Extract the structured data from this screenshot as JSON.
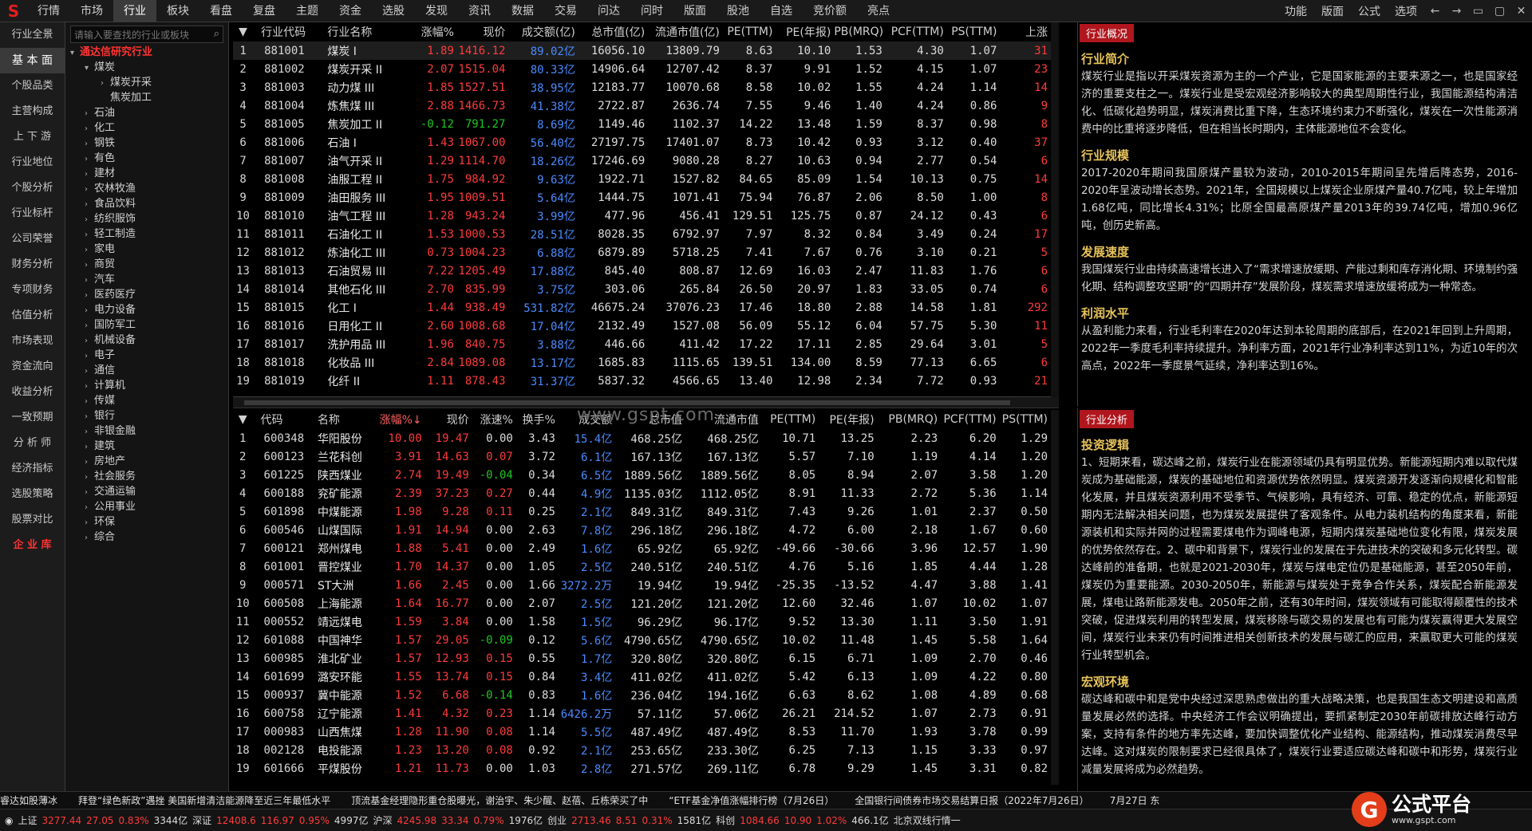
{
  "menubar": {
    "logo": "S",
    "items": [
      "行情",
      "市场",
      "行业",
      "板块",
      "看盘",
      "复盘",
      "主题",
      "资金",
      "选股",
      "发现",
      "资讯",
      "数据",
      "交易",
      "问达",
      "问时",
      "版面",
      "股池",
      "自选",
      "竞价额",
      "亮点"
    ],
    "active_index": 2,
    "right_items": [
      "功能",
      "版面",
      "公式",
      "选项"
    ],
    "window_buttons": [
      "←",
      "→",
      "▭",
      "▢",
      "✕"
    ]
  },
  "nav": {
    "items": [
      "行业全景",
      "基 本 面",
      "个股品类",
      "主营构成",
      "上 下 游",
      "行业地位",
      "个股分析",
      "行业标杆",
      "公司荣誉",
      "财务分析",
      "专项财务",
      "估值分析",
      "市场表现",
      "资金流向",
      "收益分析",
      "一致预期",
      "分 析 师",
      "经济指标",
      "选股策略",
      "股票对比",
      "企 业 库"
    ],
    "active_index": 1,
    "red_index": 20
  },
  "tree": {
    "search_placeholder": "请输入要查找的行业或板块",
    "root": "通达信研究行业",
    "items": [
      {
        "label": "煤炭",
        "level": 1,
        "arrow": "▾"
      },
      {
        "label": "煤炭开采",
        "level": 2,
        "arrow": "›"
      },
      {
        "label": "焦炭加工",
        "level": 2,
        "arrow": ""
      },
      {
        "label": "石油",
        "level": 1,
        "arrow": "›"
      },
      {
        "label": "化工",
        "level": 1,
        "arrow": "›"
      },
      {
        "label": "钢铁",
        "level": 1,
        "arrow": "›"
      },
      {
        "label": "有色",
        "level": 1,
        "arrow": "›"
      },
      {
        "label": "建材",
        "level": 1,
        "arrow": "›"
      },
      {
        "label": "农林牧渔",
        "level": 1,
        "arrow": "›"
      },
      {
        "label": "食品饮料",
        "level": 1,
        "arrow": "›"
      },
      {
        "label": "纺织服饰",
        "level": 1,
        "arrow": "›"
      },
      {
        "label": "轻工制造",
        "level": 1,
        "arrow": "›"
      },
      {
        "label": "家电",
        "level": 1,
        "arrow": "›"
      },
      {
        "label": "商贸",
        "level": 1,
        "arrow": "›"
      },
      {
        "label": "汽车",
        "level": 1,
        "arrow": "›"
      },
      {
        "label": "医药医疗",
        "level": 1,
        "arrow": "›"
      },
      {
        "label": "电力设备",
        "level": 1,
        "arrow": "›"
      },
      {
        "label": "国防军工",
        "level": 1,
        "arrow": "›"
      },
      {
        "label": "机械设备",
        "level": 1,
        "arrow": "›"
      },
      {
        "label": "电子",
        "level": 1,
        "arrow": "›"
      },
      {
        "label": "通信",
        "level": 1,
        "arrow": "›"
      },
      {
        "label": "计算机",
        "level": 1,
        "arrow": "›"
      },
      {
        "label": "传媒",
        "level": 1,
        "arrow": "›"
      },
      {
        "label": "银行",
        "level": 1,
        "arrow": "›"
      },
      {
        "label": "非银金融",
        "level": 1,
        "arrow": "›"
      },
      {
        "label": "建筑",
        "level": 1,
        "arrow": "›"
      },
      {
        "label": "房地产",
        "level": 1,
        "arrow": "›"
      },
      {
        "label": "社会服务",
        "level": 1,
        "arrow": "›"
      },
      {
        "label": "交通运输",
        "level": 1,
        "arrow": "›"
      },
      {
        "label": "公用事业",
        "level": 1,
        "arrow": "›"
      },
      {
        "label": "环保",
        "level": 1,
        "arrow": "›"
      },
      {
        "label": "综合",
        "level": 1,
        "arrow": "›"
      }
    ]
  },
  "industry_table": {
    "sort_icon": "▼",
    "headers": [
      "行业代码",
      "行业名称",
      "涨幅%",
      "现价",
      "成交额(亿)",
      "总市值(亿)",
      "流通市值(亿)",
      "PE(TTM)",
      "PE(年报)",
      "PB(MRQ)",
      "PCF(TTM)",
      "PS(TTM)",
      "上涨"
    ],
    "rows": [
      [
        "1",
        "881001",
        "煤炭 I",
        "1.89",
        "1416.12",
        "89.02亿",
        "16056.10",
        "13809.79",
        "8.63",
        "10.10",
        "1.53",
        "4.30",
        "1.07",
        "31"
      ],
      [
        "2",
        "881002",
        "煤炭开采 II",
        "2.07",
        "1515.04",
        "80.33亿",
        "14906.64",
        "12707.42",
        "8.37",
        "9.91",
        "1.52",
        "4.15",
        "1.07",
        "23"
      ],
      [
        "3",
        "881003",
        "动力煤 III",
        "1.85",
        "1527.51",
        "38.95亿",
        "12183.77",
        "10070.68",
        "8.58",
        "10.02",
        "1.55",
        "4.24",
        "1.14",
        "14"
      ],
      [
        "4",
        "881004",
        "炼焦煤 III",
        "2.88",
        "1466.73",
        "41.38亿",
        "2722.87",
        "2636.74",
        "7.55",
        "9.46",
        "1.40",
        "4.24",
        "0.86",
        "9"
      ],
      [
        "5",
        "881005",
        "焦炭加工 II",
        "-0.12",
        "791.27",
        "8.69亿",
        "1149.46",
        "1102.37",
        "14.22",
        "13.48",
        "1.59",
        "8.37",
        "0.98",
        "8"
      ],
      [
        "6",
        "881006",
        "石油 I",
        "1.43",
        "1067.00",
        "56.40亿",
        "27197.75",
        "17401.07",
        "8.73",
        "10.42",
        "0.93",
        "3.12",
        "0.40",
        "37"
      ],
      [
        "7",
        "881007",
        "油气开采 II",
        "1.29",
        "1114.70",
        "18.26亿",
        "17246.69",
        "9080.28",
        "8.27",
        "10.63",
        "0.94",
        "2.77",
        "0.54",
        "6"
      ],
      [
        "8",
        "881008",
        "油服工程 II",
        "1.75",
        "984.92",
        "9.63亿",
        "1922.71",
        "1527.82",
        "84.65",
        "85.09",
        "1.54",
        "10.13",
        "0.75",
        "14"
      ],
      [
        "9",
        "881009",
        "油田服务 III",
        "1.95",
        "1009.51",
        "5.64亿",
        "1444.75",
        "1071.41",
        "75.94",
        "76.87",
        "2.06",
        "8.50",
        "1.00",
        "8"
      ],
      [
        "10",
        "881010",
        "油气工程 III",
        "1.28",
        "943.24",
        "3.99亿",
        "477.96",
        "456.41",
        "129.51",
        "125.75",
        "0.87",
        "24.12",
        "0.43",
        "6"
      ],
      [
        "11",
        "881011",
        "石油化工 II",
        "1.53",
        "1000.53",
        "28.51亿",
        "8028.35",
        "6792.97",
        "7.97",
        "8.32",
        "0.84",
        "3.49",
        "0.24",
        "17"
      ],
      [
        "12",
        "881012",
        "炼油化工 III",
        "0.73",
        "1004.23",
        "6.88亿",
        "6879.89",
        "5718.25",
        "7.41",
        "7.67",
        "0.76",
        "3.10",
        "0.21",
        "5"
      ],
      [
        "13",
        "881013",
        "石油贸易 III",
        "7.22",
        "1205.49",
        "17.88亿",
        "845.40",
        "808.87",
        "12.69",
        "16.03",
        "2.47",
        "11.83",
        "1.76",
        "6"
      ],
      [
        "14",
        "881014",
        "其他石化 III",
        "2.70",
        "835.99",
        "3.75亿",
        "303.06",
        "265.84",
        "26.50",
        "20.97",
        "1.83",
        "33.05",
        "0.74",
        "6"
      ],
      [
        "15",
        "881015",
        "化工 I",
        "1.44",
        "938.49",
        "531.82亿",
        "46675.24",
        "37076.23",
        "17.46",
        "18.80",
        "2.88",
        "14.58",
        "1.81",
        "292"
      ],
      [
        "16",
        "881016",
        "日用化工 II",
        "2.60",
        "1008.68",
        "17.04亿",
        "2132.49",
        "1527.08",
        "56.09",
        "55.12",
        "6.04",
        "57.75",
        "5.30",
        "11"
      ],
      [
        "17",
        "881017",
        "洗护用品 III",
        "1.96",
        "840.75",
        "3.88亿",
        "446.66",
        "411.42",
        "17.22",
        "17.11",
        "2.85",
        "29.64",
        "3.01",
        "5"
      ],
      [
        "18",
        "881018",
        "化妆品 III",
        "2.84",
        "1089.08",
        "13.17亿",
        "1685.83",
        "1115.65",
        "139.51",
        "134.00",
        "8.59",
        "77.13",
        "6.65",
        "6"
      ],
      [
        "19",
        "881019",
        "化纤 II",
        "1.11",
        "878.43",
        "31.37亿",
        "5837.32",
        "4566.65",
        "13.40",
        "12.98",
        "2.34",
        "7.72",
        "0.93",
        "21"
      ]
    ]
  },
  "watermark": "www.gspt.com",
  "stock_table": {
    "sort_icon": "▼",
    "headers": [
      "代码",
      "名称",
      "涨幅%↓",
      "现价",
      "涨速%",
      "换手%",
      "成交额",
      "总市值",
      "流通市值",
      "PE(TTM)",
      "PE(年报)",
      "PB(MRQ)",
      "PCF(TTM)",
      "PS(TTM)"
    ],
    "rows": [
      [
        "1",
        "600348",
        "华阳股份",
        "10.00",
        "19.47",
        "0.00",
        "3.43",
        "15.4亿",
        "468.25亿",
        "468.25亿",
        "10.71",
        "13.25",
        "2.23",
        "6.20",
        "1.29"
      ],
      [
        "2",
        "600123",
        "兰花科创",
        "3.91",
        "14.63",
        "0.07",
        "3.72",
        "6.1亿",
        "167.13亿",
        "167.13亿",
        "5.57",
        "7.10",
        "1.19",
        "4.14",
        "1.20"
      ],
      [
        "3",
        "601225",
        "陕西煤业",
        "2.74",
        "19.49",
        "-0.04",
        "0.34",
        "6.5亿",
        "1889.56亿",
        "1889.56亿",
        "8.05",
        "8.94",
        "2.07",
        "3.58",
        "1.20"
      ],
      [
        "4",
        "600188",
        "兖矿能源",
        "2.39",
        "37.23",
        "0.27",
        "0.44",
        "4.9亿",
        "1135.03亿",
        "1112.05亿",
        "8.91",
        "11.33",
        "2.72",
        "5.36",
        "1.14"
      ],
      [
        "5",
        "601898",
        "中煤能源",
        "1.98",
        "9.28",
        "0.11",
        "0.25",
        "2.1亿",
        "849.31亿",
        "849.31亿",
        "7.43",
        "9.26",
        "1.01",
        "2.37",
        "0.50"
      ],
      [
        "6",
        "600546",
        "山煤国际",
        "1.91",
        "14.94",
        "0.00",
        "2.63",
        "7.8亿",
        "296.18亿",
        "296.18亿",
        "4.72",
        "6.00",
        "2.18",
        "1.67",
        "0.60"
      ],
      [
        "7",
        "600121",
        "郑州煤电",
        "1.88",
        "5.41",
        "0.00",
        "2.49",
        "1.6亿",
        "65.92亿",
        "65.92亿",
        "-49.66",
        "-30.66",
        "3.96",
        "12.57",
        "1.90"
      ],
      [
        "8",
        "601001",
        "晋控煤业",
        "1.70",
        "14.37",
        "0.00",
        "1.05",
        "2.5亿",
        "240.51亿",
        "240.51亿",
        "4.76",
        "5.16",
        "1.85",
        "4.44",
        "1.28"
      ],
      [
        "9",
        "000571",
        "ST大洲",
        "1.66",
        "2.45",
        "0.00",
        "1.66",
        "3272.2万",
        "19.94亿",
        "19.94亿",
        "-25.35",
        "-13.52",
        "4.47",
        "3.88",
        "1.41"
      ],
      [
        "10",
        "600508",
        "上海能源",
        "1.64",
        "16.77",
        "0.00",
        "2.07",
        "2.5亿",
        "121.20亿",
        "121.20亿",
        "12.60",
        "32.46",
        "1.07",
        "10.02",
        "1.07"
      ],
      [
        "11",
        "000552",
        "靖远煤电",
        "1.59",
        "3.84",
        "0.00",
        "1.58",
        "1.5亿",
        "96.29亿",
        "96.17亿",
        "9.52",
        "13.30",
        "1.11",
        "3.50",
        "1.91"
      ],
      [
        "12",
        "601088",
        "中国神华",
        "1.57",
        "29.05",
        "-0.09",
        "0.12",
        "5.6亿",
        "4790.65亿",
        "4790.65亿",
        "10.02",
        "11.48",
        "1.45",
        "5.58",
        "1.64"
      ],
      [
        "13",
        "600985",
        "淮北矿业",
        "1.57",
        "12.93",
        "0.15",
        "0.55",
        "1.7亿",
        "320.80亿",
        "320.80亿",
        "6.15",
        "6.71",
        "1.09",
        "2.70",
        "0.46"
      ],
      [
        "14",
        "601699",
        "潞安环能",
        "1.55",
        "13.74",
        "0.15",
        "0.84",
        "3.4亿",
        "411.02亿",
        "411.02亿",
        "5.42",
        "6.13",
        "1.09",
        "4.22",
        "0.80"
      ],
      [
        "15",
        "000937",
        "冀中能源",
        "1.52",
        "6.68",
        "-0.14",
        "0.83",
        "1.6亿",
        "236.04亿",
        "194.16亿",
        "6.63",
        "8.62",
        "1.08",
        "4.89",
        "0.68"
      ],
      [
        "16",
        "600758",
        "辽宁能源",
        "1.41",
        "4.32",
        "0.23",
        "1.14",
        "6426.2万",
        "57.11亿",
        "57.06亿",
        "26.21",
        "214.52",
        "1.07",
        "2.73",
        "0.91"
      ],
      [
        "17",
        "000983",
        "山西焦煤",
        "1.28",
        "11.90",
        "0.08",
        "1.14",
        "5.5亿",
        "487.49亿",
        "487.49亿",
        "8.53",
        "11.70",
        "1.93",
        "3.78",
        "0.99"
      ],
      [
        "18",
        "002128",
        "电投能源",
        "1.23",
        "13.20",
        "0.08",
        "0.92",
        "2.1亿",
        "253.65亿",
        "233.30亿",
        "6.25",
        "7.13",
        "1.15",
        "3.33",
        "0.97"
      ],
      [
        "19",
        "601666",
        "平煤股份",
        "1.21",
        "11.73",
        "0.00",
        "1.03",
        "2.8亿",
        "271.57亿",
        "269.11亿",
        "6.78",
        "9.29",
        "1.45",
        "3.31",
        "0.82"
      ]
    ]
  },
  "panel_overview": {
    "tab": "行业概况",
    "sections": [
      {
        "title": "行业简介",
        "text": "煤炭行业是指以开采煤炭资源为主的一个产业，它是国家能源的主要来源之一，也是国家经济的重要支柱之一。煤炭行业是受宏观经济影响较大的典型周期性行业，我国能源结构清洁化、低碳化趋势明显，煤炭消费比重下降，生态环境约束力不断强化，煤炭在一次性能源消费中的比重将逐步降低，但在相当长时期内，主体能源地位不会变化。"
      },
      {
        "title": "行业规模",
        "text": "2017-2020年期间我国原煤产量较为波动，2010-2015年期间呈先增后降态势，2016-2020年呈波动增长态势。2021年，全国规模以上煤炭企业原煤产量40.7亿吨，较上年增加1.68亿吨，同比增长4.31%；比原全国最高原煤产量2013年的39.74亿吨，增加0.96亿吨，创历史新高。"
      },
      {
        "title": "发展速度",
        "text": "我国煤炭行业由持续高速增长进入了“需求增速放缓期、产能过剩和库存消化期、环境制约强化期、结构调整攻坚期”的“四期并存”发展阶段，煤炭需求增速放缓将成为一种常态。"
      },
      {
        "title": "利润水平",
        "text": "从盈利能力来看，行业毛利率在2020年达到本轮周期的底部后，在2021年回到上升周期，2022年一季度毛利率持续提升。净利率方面，2021年行业净利率达到11%，为近10年的次高点，2022年一季度景气延续，净利率达到16%。"
      }
    ]
  },
  "panel_analysis": {
    "tab": "行业分析",
    "sections": [
      {
        "title": "投资逻辑",
        "text": "1、短期来看，碳达峰之前，煤炭行业在能源领域仍具有明显优势。新能源短期内难以取代煤炭成为基础能源，煤炭的基础地位和资源优势依然明显。煤炭资源开发逐渐向规模化和智能化发展，并且煤炭资源利用不受季节、气候影响，具有经济、可靠、稳定的优点，新能源短期内无法解决相关问题，也为煤炭发展提供了客观条件。从电力装机结构的角度来看，新能源装机和实际并网的过程需要煤电作为调峰电源，短期内煤炭基础地位变化有限，煤炭发展的优势依然存在。2、碳中和背景下，煤炭行业的发展在于先进技术的突破和多元化转型。碳达峰前的准备期，也就是2021-2030年，煤炭与煤电定位仍是基础能源，甚至2050年前，煤炭仍为重要能源。2030-2050年，新能源与煤炭处于竞争合作关系，煤炭配合新能源发展，煤电让路新能源发电。2050年之前，还有30年时间，煤炭领域有可能取得颠覆性的技术突破，促进煤炭利用的转型发展，煤炭移除与碳交易的发展也有可能为煤炭赢得更大发展空间，煤炭行业未来仍有时间推进相关创新技术的发展与碳汇的应用，来赢取更大可能的煤炭行业转型机会。"
      },
      {
        "title": "宏观环境",
        "text": "碳达峰和碳中和是党中央经过深思熟虑做出的重大战略决策，也是我国生态文明建设和高质量发展必然的选择。中央经济工作会议明确提出，要抓紧制定2030年前碳排放达峰行动方案，支持有条件的地方率先达峰，要加快调整优化产业结构、能源结构，推动煤炭消费尽早达峰。这对煤炭的限制要求已经很具体了，煤炭行业要适应碳达峰和碳中和形势，煤炭行业减量发展将成为必然趋势。"
      }
    ]
  },
  "ticker": {
    "items": [
      "睿达如股薄冰",
      "拜登“绿色新政”遇挫 美国新增清洁能源降至近三年最低水平",
      "顶流基金经理隐形重仓股曝光，谢治宇、朱少醒、赵蓓、丘栋荣买了中",
      "“ETF基金净值涨幅排行榜（7月26日）",
      "全国银行间债券市场交易结算日报（2022年7月26日）",
      "7月27日 东"
    ]
  },
  "statusbar": {
    "items": [
      {
        "label": "上证",
        "values": [
          "3277.44",
          "27.05",
          "0.83%",
          "3344亿"
        ]
      },
      {
        "label": "深证",
        "values": [
          "12408.6",
          "116.97",
          "0.95%",
          "4997亿"
        ]
      },
      {
        "label": "沪深",
        "values": [
          "4245.98",
          "33.34",
          "0.79%",
          "1976亿"
        ]
      },
      {
        "label": "创业",
        "values": [
          "2713.46",
          "8.51",
          "0.31%",
          "1581亿"
        ]
      },
      {
        "label": "科创",
        "values": [
          "1084.66",
          "10.90",
          "1.02%",
          "466.1亿"
        ]
      }
    ],
    "tail": "北京双线行情一"
  },
  "brand": {
    "logo": "G",
    "name": "公式平台",
    "url": "www.gspt.com"
  },
  "colors": {
    "up": "#ff3b3b",
    "down": "#21c521",
    "volume": "#4a8bff",
    "accent": "#b0161d",
    "heading": "#e7c35a"
  }
}
